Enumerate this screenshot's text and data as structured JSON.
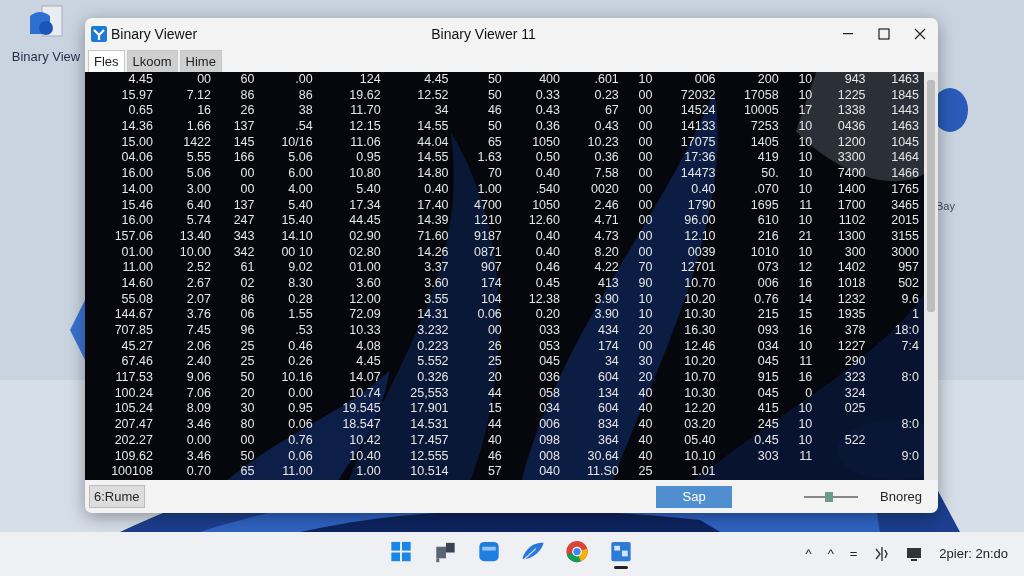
{
  "desktop": {
    "icon_label": "Binary View",
    "side_label": "Bay"
  },
  "window": {
    "app_name": "Binary Viewer",
    "title": "Binary Viewer 11",
    "tabs": [
      {
        "label": "Fles",
        "selected": true
      },
      {
        "label": "Lkoom",
        "selected": false
      },
      {
        "label": "Hime",
        "selected": false
      }
    ],
    "table": {
      "rows": [
        [
          "4.45",
          "00",
          "60",
          ".00",
          "124",
          "4.45",
          "50",
          "400",
          ".601",
          "10",
          "006",
          "200",
          "10",
          "943",
          "1463"
        ],
        [
          "15.97",
          "7.12",
          "86",
          "86",
          "19.62",
          "12.52",
          "50",
          "0.33",
          "0.23",
          "00",
          "72032",
          "17058",
          "10",
          "1225",
          "1845"
        ],
        [
          "0.65",
          "16",
          "26",
          "38",
          "11.70",
          "34",
          "46",
          "0.43",
          "67",
          "00",
          "14524",
          "10005",
          "17",
          "1338",
          "1443"
        ],
        [
          "14.36",
          "1.66",
          "137",
          ".54",
          "12.15",
          "14.55",
          "50",
          "0.36",
          "0.43",
          "00",
          "14133",
          "7253",
          "10",
          "0436",
          "1463"
        ],
        [
          "15.00",
          "1422",
          "145",
          "10/16",
          "11.06",
          "44.04",
          "65",
          "1050",
          "10.23",
          "00",
          "17075",
          "1405",
          "10",
          "1200",
          "1045"
        ],
        [
          "04.06",
          "5.55",
          "166",
          "5.06",
          "0.95",
          "14.55",
          "1.63",
          "0.50",
          "0.36",
          "00",
          "17:36",
          "419",
          "10",
          "3300",
          "1464"
        ],
        [
          "16.00",
          "5.06",
          "00",
          "6.00",
          "10.80",
          "14.80",
          "70",
          "0.40",
          "7.58",
          "00",
          "14473",
          "50.",
          "10",
          "7400",
          "1466"
        ],
        [
          "14.00",
          "3.00",
          "00",
          "4.00",
          "5.40",
          "0.40",
          "1.00",
          ".540",
          "0020",
          "00",
          "0.40",
          ".070",
          "10",
          "1400",
          "1765"
        ],
        [
          "15.46",
          "6.40",
          "137",
          "5.40",
          "17.34",
          "17.40",
          "4700",
          "1050",
          "2.46",
          "00",
          "1790",
          "1695",
          "11",
          "1700",
          "3465"
        ],
        [
          "16.00",
          "5.74",
          "247",
          "15.40",
          "44.45",
          "14.39",
          "1210",
          "12.60",
          "4.71",
          "00",
          "96.00",
          "610",
          "10",
          "1102",
          "2015"
        ],
        [
          "157.06",
          "13.40",
          "343",
          "14.10",
          "02.90",
          "71.60",
          "9187",
          "0.40",
          "4.73",
          "00",
          "12.10",
          "216",
          "21",
          "1300",
          "3155"
        ],
        [
          "01.00",
          "10.00",
          "342",
          "00 10",
          "02.80",
          "14.26",
          "0871",
          "0.40",
          "8.20",
          "00",
          "0039",
          "1010",
          "10",
          "300",
          "3000"
        ],
        [
          "11.00",
          "2.52",
          "61",
          "9.02",
          "01.00",
          "3.37",
          "907",
          "0.46",
          "4.22",
          "70",
          "12701",
          "073",
          "12",
          "1402",
          "957"
        ],
        [
          "14.60",
          "2.67",
          "02",
          "8.30",
          "3.60",
          "3.60",
          "174",
          "0.45",
          "413",
          "90",
          "10.70",
          "006",
          "16",
          "1018",
          "502"
        ],
        [
          "55.08",
          "2.07",
          "86",
          "0.28",
          "12.00",
          "3.55",
          "104",
          "12.38",
          "3.90",
          "10",
          "10.20",
          "0.76",
          "14",
          "1232",
          "9.6"
        ],
        [
          "144.67",
          "3.76",
          "06",
          "1.55",
          "72.09",
          "14.31",
          "0.06",
          "0.20",
          "3.90",
          "10",
          "10.30",
          "215",
          "15",
          "1935",
          "1"
        ],
        [
          "707.85",
          "7.45",
          "96",
          ".53",
          "10.33",
          "3.232",
          "00",
          "033",
          "434",
          "20",
          "16.30",
          "093",
          "16",
          "378",
          "18:0"
        ],
        [
          "45.27",
          "2.06",
          "25",
          "0.46",
          "4.08",
          "0.223",
          "26",
          "053",
          "174",
          "00",
          "12.46",
          "034",
          "10",
          "1227",
          "7:4"
        ],
        [
          "67.46",
          "2.40",
          "25",
          "0.26",
          "4.45",
          "5.552",
          "25",
          "045",
          "34",
          "30",
          "10.20",
          "045",
          "11",
          "290",
          null
        ],
        [
          "117.53",
          "9.06",
          "50",
          "10.16",
          "14.07",
          "0.326",
          "20",
          "036",
          "604",
          "20",
          "10.70",
          "915",
          "16",
          "323",
          "8:0"
        ],
        [
          "100.24",
          "7.06",
          "20",
          "0.00",
          "10.74",
          "25,553",
          "44",
          "058",
          "134",
          "40",
          "10.30",
          "045",
          "0",
          "324",
          null
        ],
        [
          "105.24",
          "8.09",
          "30",
          "0.95",
          "19.545",
          "17.901",
          "15",
          "034",
          "604",
          "40",
          "12.20",
          "415",
          "10",
          "025",
          null
        ],
        [
          "207.47",
          "3.46",
          "80",
          "0.06",
          "18.547",
          "14.531",
          "44",
          "006",
          "834",
          "40",
          "03.20",
          "245",
          "10",
          null,
          "8:0"
        ],
        [
          "202.27",
          "0.00",
          "00",
          "0.76",
          "10.42",
          "17.457",
          "40",
          "098",
          "364",
          "40",
          "05.40",
          "0.45",
          "10",
          "522",
          null
        ],
        [
          "109.62",
          "3.46",
          "50",
          "0.06",
          "10.40",
          "12.555",
          "46",
          "008",
          "30.64",
          "40",
          "10.10",
          "303",
          "11",
          null,
          "9:0"
        ],
        [
          "100108",
          "0.70",
          "65",
          "11.00",
          "1.00",
          "10.514",
          "57",
          "040",
          "11.S0",
          "25",
          "1.01",
          null,
          null,
          null,
          null
        ]
      ]
    },
    "status_bar": {
      "mode": "6:Rume",
      "button": "Sap",
      "zoom": {
        "level": 0.45
      },
      "status": "Bnoreg"
    }
  },
  "taskbar": {
    "apps": [
      {
        "kind": "start",
        "active": false
      },
      {
        "kind": "widgets",
        "active": false
      },
      {
        "kind": "box",
        "active": false
      },
      {
        "kind": "feather",
        "active": false
      },
      {
        "kind": "browser",
        "active": false
      },
      {
        "kind": "viewer",
        "active": true
      }
    ],
    "tray": [
      "^",
      "^",
      "="
    ],
    "clock": "2pier: 2n:do"
  }
}
